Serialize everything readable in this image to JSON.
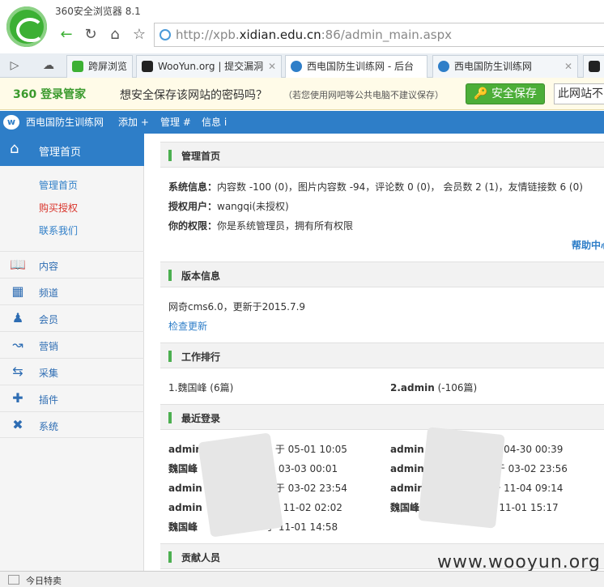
{
  "browser": {
    "title": "360安全浏览器 8.1",
    "url_prefix": "http://xpb.",
    "url_domain": "xidian.edu.cn",
    "url_suffix": ":86/admin_main.aspx",
    "tabs": [
      {
        "label": "跨屏浏览",
        "color": "#3cb034"
      },
      {
        "label": "WooYun.org | 提交漏洞",
        "color": "#222222"
      },
      {
        "label": "西电国防生训练网 - 后台",
        "color": "#2e7ec8"
      },
      {
        "label": "西电国防生训练网",
        "color": "#2e7ec8"
      }
    ]
  },
  "password_bar": {
    "brand": "360 登录管家",
    "message": "想安全保存该网站的密码吗？",
    "note": "（若您使用网吧等公共电脑不建议保存）",
    "save_label": "安全保存",
    "never_label": "此网站不"
  },
  "site": {
    "logo": "w",
    "name": "西电国防生训练网",
    "menu": [
      "添加 +",
      "管理 #",
      "信息 i"
    ]
  },
  "sidebar": {
    "home": "管理首页",
    "sublinks": [
      "管理首页",
      "购买授权",
      "联系我们"
    ],
    "sections": [
      {
        "label": "内容",
        "icon": "book-icon"
      },
      {
        "label": "频道",
        "icon": "grid-icon"
      },
      {
        "label": "会员",
        "icon": "user-icon"
      },
      {
        "label": "营销",
        "icon": "chart-icon"
      },
      {
        "label": "采集",
        "icon": "sync-icon"
      },
      {
        "label": "插件",
        "icon": "puzzle-icon"
      },
      {
        "label": "系统",
        "icon": "tools-icon"
      }
    ]
  },
  "main": {
    "home_title": "管理首页",
    "sys_label": "系统信息：",
    "sys_text": "内容数 -100 (0)，图片内容数 -94，评论数 0 (0)， 会员数 2 (1)，友情链接数 6 (0)",
    "user_label": "授权用户：",
    "user_text": "wangqi(未授权)",
    "perm_label": "你的权限：",
    "perm_text": "你是系统管理员，拥有所有权限",
    "help_link": "帮助中心",
    "version_title": "版本信息",
    "version_text": "网奇cms6.0，更新于2015.7.9",
    "update_link": "检查更新",
    "rank_title": "工作排行",
    "rank1": "1.魏国峰 (6篇)",
    "rank2_name": "2.admin",
    "rank2_count": "(-106篇)",
    "login_title": "最近登录",
    "logins_left": [
      {
        "name": "admin",
        "time": "于 05-01 10:05"
      },
      {
        "name": "魏国峰",
        "time": "于 03-03 00:01"
      },
      {
        "name": "admin",
        "time": "于 03-02 23:54"
      },
      {
        "name": "admin",
        "time": "于 11-02 02:02"
      },
      {
        "name": "魏国峰",
        "time": "于 11-01 14:58"
      }
    ],
    "logins_right": [
      {
        "name": "admin",
        "time": ") 于 04-30 00:39"
      },
      {
        "name": "admin",
        "time": "于 03-02 23:56"
      },
      {
        "name": "admin",
        "time": ") 于 11-04 09:14"
      },
      {
        "name": "魏国峰",
        "time": ") 于 11-01 15:17"
      }
    ],
    "contrib_title": "贡献人员"
  },
  "watermark": "www.wooyun.org",
  "status": {
    "label": "今日特卖"
  }
}
